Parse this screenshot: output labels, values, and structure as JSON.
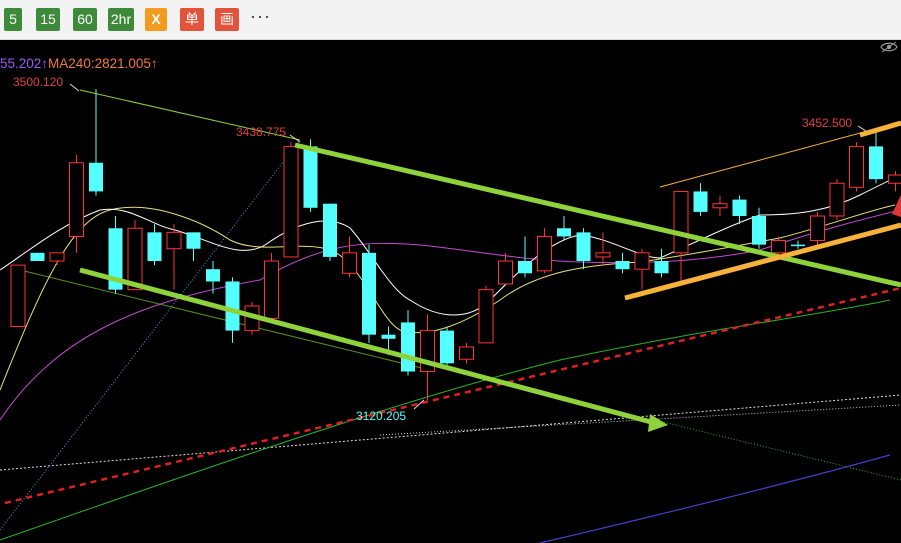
{
  "toolbar": {
    "buttons": [
      {
        "label": "5"
      },
      {
        "label": "15"
      },
      {
        "label": "60"
      },
      {
        "label": "2hr"
      },
      {
        "label": "X"
      },
      {
        "label": "单"
      },
      {
        "label": "画"
      }
    ],
    "more_label": "···"
  },
  "indicators": {
    "ma_a": "55.202↑",
    "ma_b": "MA240:2821.005↑"
  },
  "price_labels": {
    "high1": "3500.120",
    "high2": "3438.775",
    "low1": "3120.205",
    "high3": "3452.500"
  },
  "colors": {
    "background": "#000000",
    "candle_up": "#ff3333",
    "candle_down": "#54ffff",
    "channel_green": "#8fd33c",
    "channel_orange": "#f7b23b",
    "ma_purple": "#c34bd0",
    "ma_yellow": "#e8e27a",
    "ma_white": "#ffffff",
    "trend_red": "#e02020"
  },
  "chart_data": {
    "type": "candlestick",
    "candles": [
      {
        "o": 3210,
        "h": 3285,
        "l": 3210,
        "c": 3285,
        "dir": "up"
      },
      {
        "o": 3300,
        "h": 3300,
        "l": 3290,
        "c": 3290,
        "dir": "down"
      },
      {
        "o": 3290,
        "h": 3300,
        "l": 3285,
        "c": 3300,
        "dir": "up"
      },
      {
        "o": 3320,
        "h": 3420,
        "l": 3300,
        "c": 3410,
        "dir": "up"
      },
      {
        "o": 3410,
        "h": 3500,
        "l": 3370,
        "c": 3375,
        "dir": "down"
      },
      {
        "o": 3330,
        "h": 3345,
        "l": 3250,
        "c": 3255,
        "dir": "down"
      },
      {
        "o": 3255,
        "h": 3340,
        "l": 3255,
        "c": 3330,
        "dir": "up"
      },
      {
        "o": 3325,
        "h": 3335,
        "l": 3285,
        "c": 3290,
        "dir": "down"
      },
      {
        "o": 3305,
        "h": 3335,
        "l": 3255,
        "c": 3325,
        "dir": "up"
      },
      {
        "o": 3325,
        "h": 3325,
        "l": 3290,
        "c": 3305,
        "dir": "down"
      },
      {
        "o": 3280,
        "h": 3290,
        "l": 3250,
        "c": 3265,
        "dir": "down"
      },
      {
        "o": 3265,
        "h": 3270,
        "l": 3190,
        "c": 3205,
        "dir": "down"
      },
      {
        "o": 3205,
        "h": 3240,
        "l": 3200,
        "c": 3235,
        "dir": "up"
      },
      {
        "o": 3220,
        "h": 3300,
        "l": 3220,
        "c": 3290,
        "dir": "up"
      },
      {
        "o": 3295,
        "h": 3435,
        "l": 3295,
        "c": 3430,
        "dir": "up"
      },
      {
        "o": 3430,
        "h": 3438.775,
        "l": 3350,
        "c": 3355,
        "dir": "down"
      },
      {
        "o": 3360,
        "h": 3360,
        "l": 3290,
        "c": 3295,
        "dir": "down"
      },
      {
        "o": 3300,
        "h": 3320,
        "l": 3270,
        "c": 3275,
        "dir": "up"
      },
      {
        "o": 3300,
        "h": 3310,
        "l": 3190,
        "c": 3200,
        "dir": "down"
      },
      {
        "o": 3200,
        "h": 3210,
        "l": 3175,
        "c": 3195,
        "dir": "down"
      },
      {
        "o": 3215,
        "h": 3230,
        "l": 3150,
        "c": 3155,
        "dir": "down"
      },
      {
        "o": 3155,
        "h": 3225,
        "l": 3120.205,
        "c": 3205,
        "dir": "up"
      },
      {
        "o": 3205,
        "h": 3210,
        "l": 3160,
        "c": 3165,
        "dir": "down"
      },
      {
        "o": 3170,
        "h": 3190,
        "l": 3165,
        "c": 3185,
        "dir": "up"
      },
      {
        "o": 3190,
        "h": 3260,
        "l": 3190,
        "c": 3255,
        "dir": "up"
      },
      {
        "o": 3262,
        "h": 3300,
        "l": 3262,
        "c": 3290,
        "dir": "up"
      },
      {
        "o": 3290,
        "h": 3320,
        "l": 3270,
        "c": 3275,
        "dir": "down"
      },
      {
        "o": 3278,
        "h": 3330,
        "l": 3275,
        "c": 3320,
        "dir": "up"
      },
      {
        "o": 3330,
        "h": 3345,
        "l": 3315,
        "c": 3320,
        "dir": "down"
      },
      {
        "o": 3325,
        "h": 3330,
        "l": 3280,
        "c": 3290,
        "dir": "down"
      },
      {
        "o": 3295,
        "h": 3325,
        "l": 3285,
        "c": 3300,
        "dir": "up"
      },
      {
        "o": 3290,
        "h": 3300,
        "l": 3275,
        "c": 3280,
        "dir": "down"
      },
      {
        "o": 3280,
        "h": 3305,
        "l": 3255,
        "c": 3300,
        "dir": "up"
      },
      {
        "o": 3290,
        "h": 3305,
        "l": 3270,
        "c": 3275,
        "dir": "down"
      },
      {
        "o": 3300,
        "h": 3375,
        "l": 3265,
        "c": 3375,
        "dir": "up"
      },
      {
        "o": 3375,
        "h": 3385,
        "l": 3345,
        "c": 3350,
        "dir": "down"
      },
      {
        "o": 3355,
        "h": 3370,
        "l": 3345,
        "c": 3360,
        "dir": "up"
      },
      {
        "o": 3365,
        "h": 3370,
        "l": 3335,
        "c": 3345,
        "dir": "down"
      },
      {
        "o": 3345,
        "h": 3355,
        "l": 3305,
        "c": 3310,
        "dir": "down"
      },
      {
        "o": 3300,
        "h": 3320,
        "l": 3295,
        "c": 3315,
        "dir": "up"
      },
      {
        "o": 3310,
        "h": 3315,
        "l": 3305,
        "c": 3310,
        "dir": "down"
      },
      {
        "o": 3315,
        "h": 3350,
        "l": 3310,
        "c": 3345,
        "dir": "up"
      },
      {
        "o": 3345,
        "h": 3390,
        "l": 3340,
        "c": 3385,
        "dir": "up"
      },
      {
        "o": 3380,
        "h": 3435,
        "l": 3375,
        "c": 3430,
        "dir": "up"
      },
      {
        "o": 3430,
        "h": 3452.5,
        "l": 3385,
        "c": 3390,
        "dir": "down"
      },
      {
        "o": 3385,
        "h": 3400,
        "l": 3375,
        "c": 3395,
        "dir": "up"
      }
    ]
  }
}
